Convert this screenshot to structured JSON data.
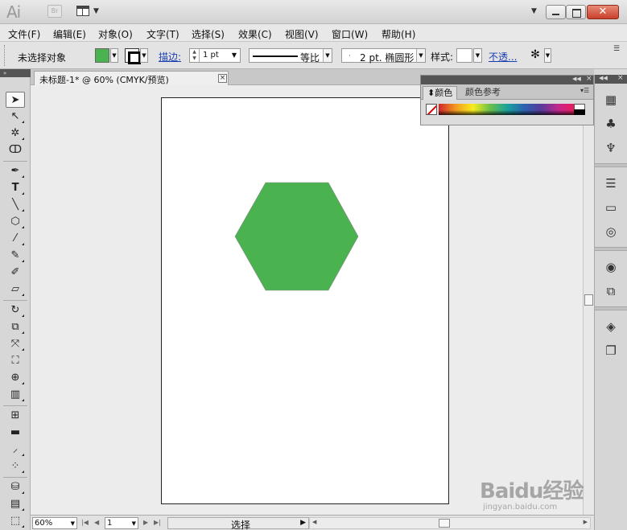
{
  "app": {
    "logo": "Ai",
    "bridge_label": "Br"
  },
  "menu": [
    "文件(F)",
    "编辑(E)",
    "对象(O)",
    "文字(T)",
    "选择(S)",
    "效果(C)",
    "视图(V)",
    "窗口(W)",
    "帮助(H)"
  ],
  "control_bar": {
    "status": "未选择对象",
    "fill_color": "#4ab34f",
    "stroke_color": "#000000",
    "stroke_label": "描边:",
    "stroke_weight": "1 pt",
    "profile": "等比",
    "brush": "2 pt. 椭圆形",
    "style_label": "样式:",
    "opacity_label": "不透..."
  },
  "document": {
    "tab_title": "未标题-1* @ 60% (CMYK/预览)"
  },
  "shape": {
    "type": "hexagon",
    "fill": "#4ab34f"
  },
  "color_panel": {
    "tabs": [
      "颜色",
      "颜色参考"
    ],
    "active_tab": "颜色"
  },
  "status_bar": {
    "zoom": "60%",
    "page": "1",
    "status_text": "选择"
  },
  "watermark": {
    "main": "Baidu经验",
    "sub": "jingyan.baidu.com"
  }
}
